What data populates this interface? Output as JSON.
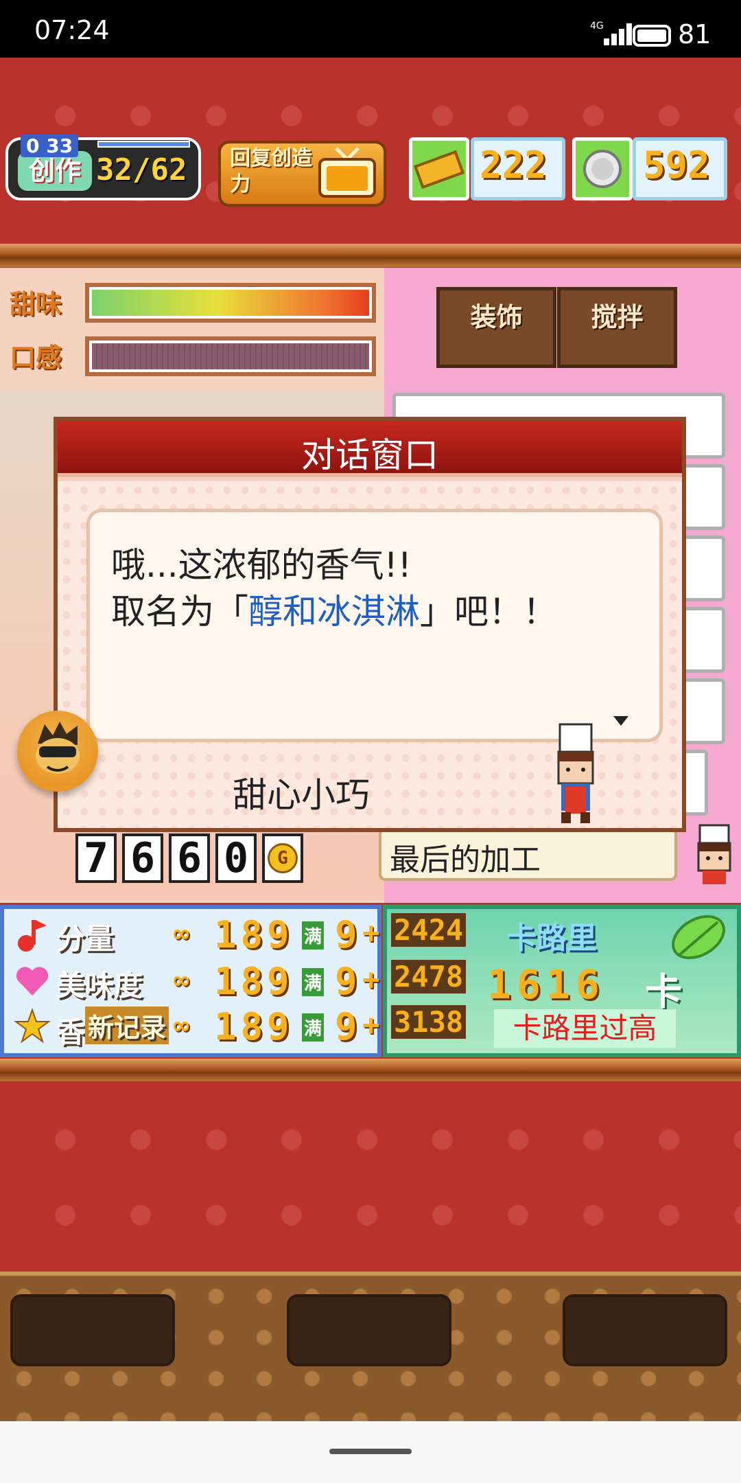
{
  "status_bar": {
    "time": "07:24",
    "network": "4G",
    "battery": "81"
  },
  "hud": {
    "create_label": "创作",
    "create_level": "0 33",
    "create_count": "32/62",
    "restore_button": "回复创造力",
    "tickets": "222",
    "medals": "592"
  },
  "flavor": {
    "sweet_label": "甜味",
    "texture_label": "口感"
  },
  "tabs": {
    "decoration": "装饰",
    "stir": "搅拌"
  },
  "dialog": {
    "title": "对话窗口",
    "line1": "哦...这浓郁的香气!!",
    "line2_prefix": "取名为「",
    "dish_name": "醇和冰淇淋",
    "line2_suffix": "」吧！！",
    "speaker": "甜心小巧"
  },
  "gold": {
    "digits": [
      "7",
      "6",
      "6",
      "0"
    ],
    "unit": "G"
  },
  "final_process": "最后的加工",
  "stats": {
    "rows": [
      {
        "label": "分量",
        "value": "189",
        "man": "满",
        "nine": "9",
        "bonus": "2424"
      },
      {
        "label": "美味度",
        "value": "189",
        "man": "满",
        "nine": "9",
        "bonus": "2478"
      },
      {
        "label": "新记录",
        "value": "189",
        "man": "满",
        "nine": "9",
        "bonus": "3138"
      }
    ],
    "star_label_prefix": "香",
    "calorie_label": "卡路里",
    "calorie_value": "1616",
    "calorie_unit": "卡",
    "calorie_warning": "卡路里过高"
  },
  "colors": {
    "accent_red": "#b9322b",
    "gold": "#f7b11e",
    "highlight_blue": "#1c5fc0",
    "warning_red": "#e41e1e"
  }
}
